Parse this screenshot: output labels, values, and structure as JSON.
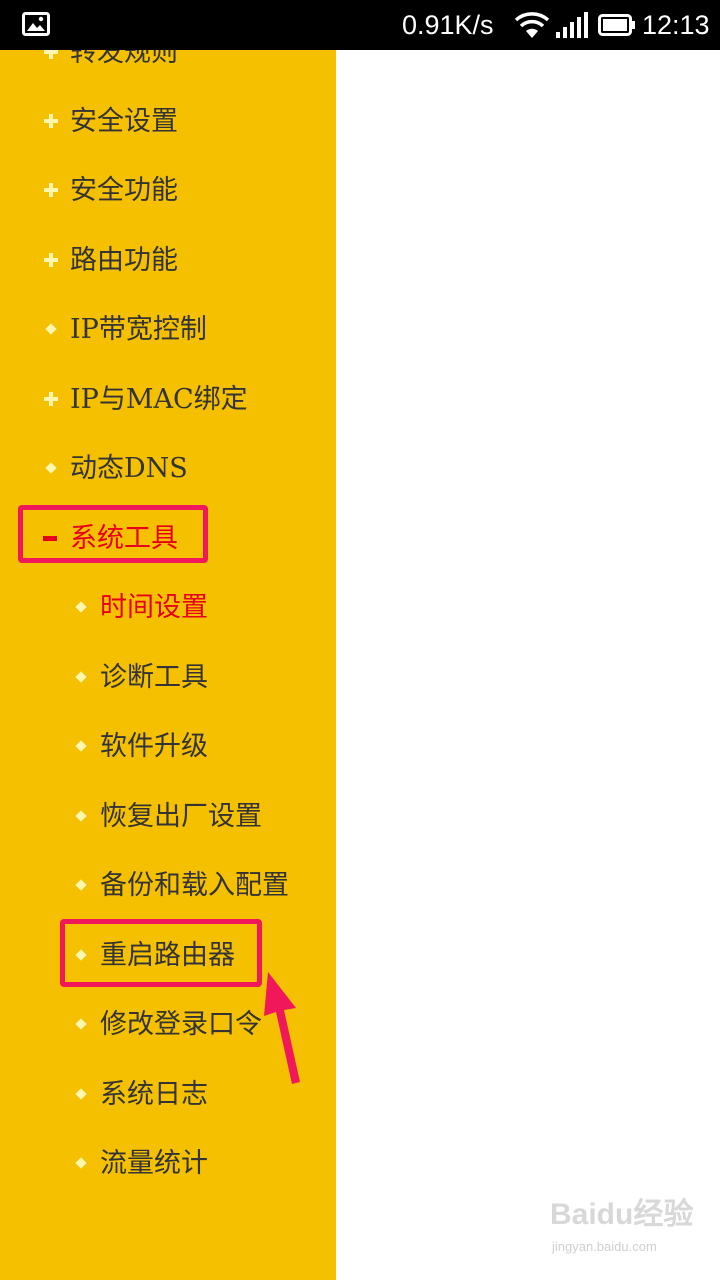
{
  "status_bar": {
    "speed": "0.91K/s",
    "time": "12:13",
    "icons": [
      "image-icon",
      "wifi-icon",
      "signal-icon",
      "battery-icon"
    ]
  },
  "menu": {
    "top_items": [
      {
        "label": "转发规则",
        "icon": "plus"
      },
      {
        "label": "安全设置",
        "icon": "plus"
      },
      {
        "label": "安全功能",
        "icon": "plus"
      },
      {
        "label": "路由功能",
        "icon": "plus"
      },
      {
        "label": "IP带宽控制",
        "icon": "dot"
      },
      {
        "label": "IP与MAC绑定",
        "icon": "plus"
      },
      {
        "label": "动态DNS",
        "icon": "dot"
      },
      {
        "label": "系统工具",
        "icon": "minus",
        "expanded": true
      }
    ],
    "sub_items": [
      {
        "label": "时间设置",
        "active": true
      },
      {
        "label": "诊断工具"
      },
      {
        "label": "软件升级"
      },
      {
        "label": "恢复出厂设置"
      },
      {
        "label": "备份和载入配置"
      },
      {
        "label": "重启路由器",
        "highlighted": true
      },
      {
        "label": "修改登录口令"
      },
      {
        "label": "系统日志"
      },
      {
        "label": "流量统计"
      }
    ]
  },
  "colors": {
    "sidebar": "#f5c000",
    "highlight": "#f0185a",
    "active_text": "#e8001a"
  },
  "watermark": {
    "logo": "Baidu经验",
    "url": "jingyan.baidu.com"
  }
}
